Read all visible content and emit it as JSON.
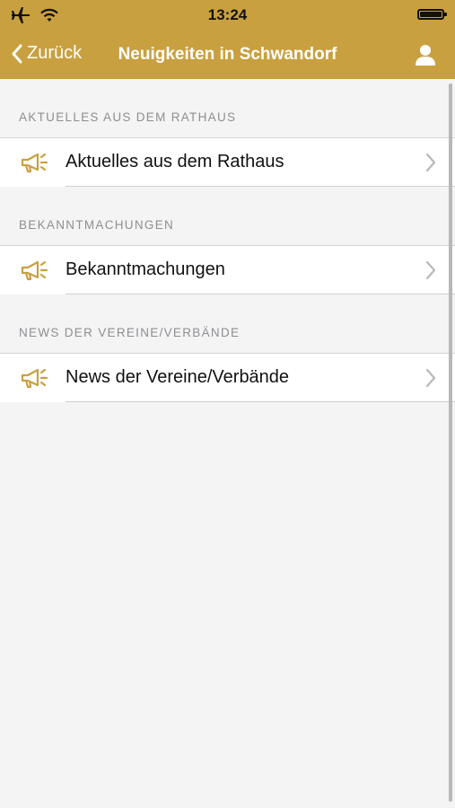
{
  "status_bar": {
    "time": "13:24",
    "icons": [
      "airplane-icon",
      "wifi-icon",
      "battery-icon"
    ]
  },
  "nav": {
    "back_label": "Zurück",
    "title": "Neuigkeiten in Schwandorf",
    "right_icon": "person-icon"
  },
  "sections": [
    {
      "header": "AKTUELLES AUS DEM RATHAUS",
      "items": [
        {
          "label": "Aktuelles aus dem Rathaus",
          "icon": "megaphone-icon"
        }
      ]
    },
    {
      "header": "BEKANNTMACHUNGEN",
      "items": [
        {
          "label": "Bekanntmachungen",
          "icon": "megaphone-icon"
        }
      ]
    },
    {
      "header": "NEWS DER VEREINE/VERBÄNDE",
      "items": [
        {
          "label": "News der Vereine/Verbände",
          "icon": "megaphone-icon"
        }
      ]
    }
  ],
  "colors": {
    "accent": "#c9a040",
    "icon": "#c9a040",
    "background": "#f4f4f4",
    "section_header_text": "#8e8e93",
    "chevron": "#b8b8b8"
  }
}
